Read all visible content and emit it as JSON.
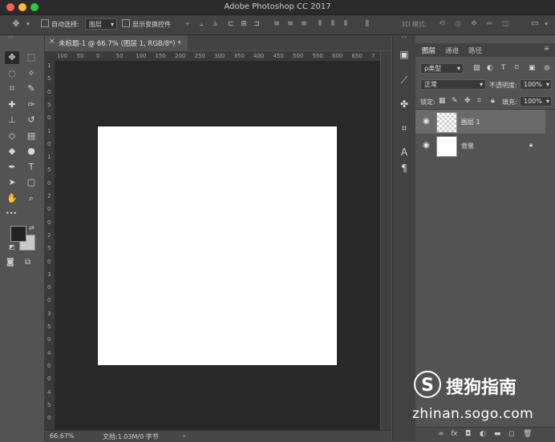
{
  "window": {
    "title": "Adobe Photoshop CC 2017",
    "traffic_lights": [
      "#fc5f57",
      "#fdbc2e",
      "#28c840"
    ]
  },
  "options_bar": {
    "auto_select_label": "自动选择:",
    "auto_select_target": "图层",
    "show_transform_label": "显示变换控件",
    "mode_3d_label": "3D 模式:"
  },
  "document": {
    "tab_title": "未标题-1 @ 66.7% (图层 1, RGB/8*) *",
    "close_glyph": "×",
    "canvas_color": "#ffffff",
    "workspace_color": "#282828"
  },
  "ruler": {
    "h_labels": [
      "100",
      "50",
      "0",
      "50",
      "100",
      "150",
      "200",
      "250",
      "300",
      "350",
      "400",
      "450",
      "500",
      "550",
      "600",
      "650",
      "7"
    ],
    "v_labels": [
      "1",
      "5",
      "0",
      "5",
      "0",
      "1",
      "0",
      "1",
      "5",
      "0",
      "2",
      "0",
      "0",
      "2",
      "5",
      "0",
      "3",
      "0",
      "0",
      "3",
      "5",
      "0",
      "4",
      "0",
      "0",
      "4",
      "5",
      "0"
    ]
  },
  "status_bar": {
    "zoom": "66.67%",
    "doc_info": "文档:1.03M/0 字节",
    "arrow": "›"
  },
  "tools": [
    {
      "name": "move-tool",
      "glyph": "✥",
      "active": true
    },
    {
      "name": "marquee-tool",
      "glyph": "⬚"
    },
    {
      "name": "lasso-tool",
      "glyph": "◌"
    },
    {
      "name": "magic-wand-tool",
      "glyph": "✧"
    },
    {
      "name": "crop-tool",
      "glyph": "⌗"
    },
    {
      "name": "eyedropper-tool",
      "glyph": "✎"
    },
    {
      "name": "healing-brush-tool",
      "glyph": "✚"
    },
    {
      "name": "brush-tool",
      "glyph": "✑"
    },
    {
      "name": "clone-stamp-tool",
      "glyph": "⊥"
    },
    {
      "name": "history-brush-tool",
      "glyph": "↺"
    },
    {
      "name": "eraser-tool",
      "glyph": "◇"
    },
    {
      "name": "gradient-tool",
      "glyph": "▤"
    },
    {
      "name": "blur-tool",
      "glyph": "◆"
    },
    {
      "name": "dodge-tool",
      "glyph": "●"
    },
    {
      "name": "pen-tool",
      "glyph": "✒"
    },
    {
      "name": "type-tool",
      "glyph": "T"
    },
    {
      "name": "path-selection-tool",
      "glyph": "➤"
    },
    {
      "name": "rectangle-tool",
      "glyph": "▢"
    },
    {
      "name": "hand-tool",
      "glyph": "✋"
    },
    {
      "name": "zoom-tool",
      "glyph": "⌕"
    }
  ],
  "toolbar_extra": {
    "more_glyph": "•••"
  },
  "colors": {
    "foreground": "#232323",
    "background": "#c8c8c8"
  },
  "panels": {
    "tabs": [
      "图层",
      "通道",
      "路径"
    ],
    "active_tab": "图层",
    "filter_kind": "ρ类型",
    "blend_mode": "正常",
    "opacity_label": "不透明度:",
    "opacity_value": "100%",
    "lock_label": "锁定:",
    "fill_label": "填充:",
    "fill_value": "100%",
    "layers": [
      {
        "name": "图层 1",
        "selected": true,
        "thumbnail": "transparent"
      },
      {
        "name": "背景",
        "selected": false,
        "thumbnail": "white",
        "locked": true
      }
    ],
    "footer_fx": "fx"
  },
  "watermark": {
    "logo_letter": "S",
    "brand": "搜狗指南",
    "url": "zhinan.sogo.com"
  }
}
